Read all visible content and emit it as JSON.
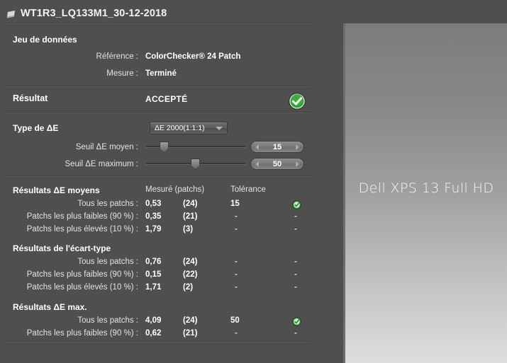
{
  "window": {
    "title": "WT1R3_LQ133M1_30-12-2018",
    "title_icon": "document-slab-icon"
  },
  "dataset": {
    "heading": "Jeu de données",
    "reference_label": "Référence :",
    "reference_value": "ColorChecker® 24 Patch",
    "measure_label": "Mesure :",
    "measure_value": "Terminé"
  },
  "result": {
    "label": "Résultat",
    "value": "ACCEPTÉ",
    "status_icon": "green-check-icon"
  },
  "delta_e_type": {
    "label": "Type de ΔE",
    "selected": "ΔE 2000(1:1:1)",
    "arrow_icon": "chevron-down-icon"
  },
  "thresholds": [
    {
      "label": "Seuil ΔE moyen :",
      "value": "15",
      "knob_percent": 14,
      "dec_icon": "arrow-left-icon",
      "inc_icon": "arrow-right-icon"
    },
    {
      "label": "Seuil ΔE maximum :",
      "value": "50",
      "knob_percent": 45,
      "dec_icon": "arrow-left-icon",
      "inc_icon": "arrow-right-icon"
    }
  ],
  "table": {
    "columns": {
      "measured": "Mesuré (patchs)",
      "tolerance": "Tolérance"
    },
    "dash": "-",
    "sections": [
      {
        "heading": "Résultats ΔE moyens",
        "show_columns": true,
        "rows": [
          {
            "label": "Tous les patchs :",
            "measured": "0,53",
            "patches": "(24)",
            "tolerance": "15",
            "status": "pass",
            "status_icon": "green-check-icon"
          },
          {
            "label": "Patchs les plus faibles (90 %) :",
            "measured": "0,35",
            "patches": "(21)",
            "tolerance": "-",
            "status": "none",
            "status_icon": ""
          },
          {
            "label": "Patchs les plus élevés (10 %) :",
            "measured": "1,79",
            "patches": "(3)",
            "tolerance": "-",
            "status": "none",
            "status_icon": ""
          }
        ]
      },
      {
        "heading": "Résultats de l'écart-type",
        "show_columns": false,
        "rows": [
          {
            "label": "Tous les patchs :",
            "measured": "0,76",
            "patches": "(24)",
            "tolerance": "-",
            "status": "none",
            "status_icon": ""
          },
          {
            "label": "Patchs les plus faibles (90 %) :",
            "measured": "0,15",
            "patches": "(22)",
            "tolerance": "-",
            "status": "none",
            "status_icon": ""
          },
          {
            "label": "Patchs les plus élevés (10 %) :",
            "measured": "1,71",
            "patches": "(2)",
            "tolerance": "-",
            "status": "none",
            "status_icon": ""
          }
        ]
      },
      {
        "heading": "Résultats ΔE max.",
        "show_columns": false,
        "rows": [
          {
            "label": "Tous les patchs :",
            "measured": "4,09",
            "patches": "(24)",
            "tolerance": "50",
            "status": "pass",
            "status_icon": "green-check-icon"
          },
          {
            "label": "Patchs les plus faibles (90 %) :",
            "measured": "0,62",
            "patches": "(21)",
            "tolerance": "-",
            "status": "none",
            "status_icon": ""
          }
        ]
      }
    ]
  },
  "preview": {
    "device_name": "Dell XPS 13 Full HD"
  },
  "colors": {
    "panel_bg": "#4f4f4f",
    "accent_green": "#3aa03a",
    "text": "#ffffff"
  }
}
